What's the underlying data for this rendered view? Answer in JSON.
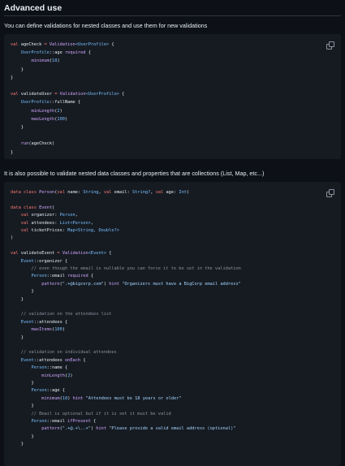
{
  "section": {
    "title": "Advanced use",
    "intro": "You can define validations for nested classes and use them for new validations",
    "middle": "It is also possible to validate nested data classes and properties that are collections (List, Map, etc...)"
  },
  "code1": {
    "lines": [
      [
        [
          "kw",
          "val "
        ],
        [
          "df",
          "ageCheck "
        ],
        [
          "kw",
          "= "
        ],
        [
          "fn",
          "Validation"
        ],
        [
          "tp",
          "<UserProfile>"
        ],
        [
          "df",
          " {"
        ]
      ],
      [
        [
          "tp",
          "    UserProfile"
        ],
        [
          "df",
          "::age "
        ],
        [
          "fn",
          "required"
        ],
        [
          "df",
          " {"
        ]
      ],
      [
        [
          "fn",
          "        minimum"
        ],
        [
          "df",
          "("
        ],
        [
          "nm",
          "18"
        ],
        [
          "df",
          ")"
        ]
      ],
      [
        [
          "df",
          "    }"
        ]
      ],
      [
        [
          "df",
          "}"
        ]
      ],
      [
        [
          "df",
          ""
        ]
      ],
      [
        [
          "kw",
          "val "
        ],
        [
          "df",
          "validateUser "
        ],
        [
          "kw",
          "= "
        ],
        [
          "fn",
          "Validation"
        ],
        [
          "tp",
          "<UserProfile>"
        ],
        [
          "df",
          " {"
        ]
      ],
      [
        [
          "tp",
          "    UserProfile"
        ],
        [
          "df",
          "::fullName {"
        ]
      ],
      [
        [
          "fn",
          "        minLength"
        ],
        [
          "df",
          "("
        ],
        [
          "nm",
          "2"
        ],
        [
          "df",
          ")"
        ]
      ],
      [
        [
          "fn",
          "        maxLength"
        ],
        [
          "df",
          "("
        ],
        [
          "nm",
          "100"
        ],
        [
          "df",
          ")"
        ]
      ],
      [
        [
          "df",
          "    }"
        ]
      ],
      [
        [
          "df",
          ""
        ]
      ],
      [
        [
          "fn",
          "    run"
        ],
        [
          "df",
          "(ageCheck)"
        ]
      ],
      [
        [
          "df",
          "}"
        ]
      ]
    ]
  },
  "code2": {
    "lines": [
      [
        [
          "kw",
          "data class "
        ],
        [
          "fn",
          "Person"
        ],
        [
          "df",
          "("
        ],
        [
          "kw",
          "val "
        ],
        [
          "df",
          "name: "
        ],
        [
          "tp",
          "String"
        ],
        [
          "df",
          ", "
        ],
        [
          "kw",
          "val "
        ],
        [
          "df",
          "email: "
        ],
        [
          "tp",
          "String?"
        ],
        [
          "df",
          ", "
        ],
        [
          "kw",
          "val "
        ],
        [
          "df",
          "age: "
        ],
        [
          "tp",
          "Int"
        ],
        [
          "df",
          ")"
        ]
      ],
      [
        [
          "df",
          ""
        ]
      ],
      [
        [
          "kw",
          "data class "
        ],
        [
          "fn",
          "Event"
        ],
        [
          "df",
          "("
        ]
      ],
      [
        [
          "kw",
          "    val "
        ],
        [
          "df",
          "organizer: "
        ],
        [
          "tp",
          "Person"
        ],
        [
          "df",
          ","
        ]
      ],
      [
        [
          "kw",
          "    val "
        ],
        [
          "df",
          "attendees: "
        ],
        [
          "tp",
          "List<Person>"
        ],
        [
          "df",
          ","
        ]
      ],
      [
        [
          "kw",
          "    val "
        ],
        [
          "df",
          "ticketPrices: "
        ],
        [
          "tp",
          "Map<String, Double?>"
        ]
      ],
      [
        [
          "df",
          ")"
        ]
      ],
      [
        [
          "df",
          ""
        ]
      ],
      [
        [
          "kw",
          "val "
        ],
        [
          "df",
          "validateEvent "
        ],
        [
          "kw",
          "= "
        ],
        [
          "fn",
          "Validation"
        ],
        [
          "tp",
          "<Event>"
        ],
        [
          "df",
          " {"
        ]
      ],
      [
        [
          "tp",
          "    Event"
        ],
        [
          "df",
          "::organizer {"
        ]
      ],
      [
        [
          "cm",
          "        // even though the email is nullable you can force it to be set in the validation"
        ]
      ],
      [
        [
          "tp",
          "        Person"
        ],
        [
          "df",
          "::email "
        ],
        [
          "fn",
          "required"
        ],
        [
          "df",
          " {"
        ]
      ],
      [
        [
          "fn",
          "            pattern"
        ],
        [
          "df",
          "("
        ],
        [
          "st",
          "\".+@bigcorp.com\""
        ],
        [
          "df",
          ") "
        ],
        [
          "fn",
          "hint "
        ],
        [
          "st",
          "\"Organizers must have a BigCorp email address\""
        ]
      ],
      [
        [
          "df",
          "        }"
        ]
      ],
      [
        [
          "df",
          "    }"
        ]
      ],
      [
        [
          "df",
          ""
        ]
      ],
      [
        [
          "cm",
          "    // validation on the attendees list"
        ]
      ],
      [
        [
          "tp",
          "    Event"
        ],
        [
          "df",
          "::attendees {"
        ]
      ],
      [
        [
          "fn",
          "        maxItems"
        ],
        [
          "df",
          "("
        ],
        [
          "nm",
          "100"
        ],
        [
          "df",
          ")"
        ]
      ],
      [
        [
          "df",
          "    }"
        ]
      ],
      [
        [
          "df",
          ""
        ]
      ],
      [
        [
          "cm",
          "    // validation on individual attendees"
        ]
      ],
      [
        [
          "tp",
          "    Event"
        ],
        [
          "df",
          "::attendees "
        ],
        [
          "fn",
          "onEach"
        ],
        [
          "df",
          " {"
        ]
      ],
      [
        [
          "tp",
          "        Person"
        ],
        [
          "df",
          "::name {"
        ]
      ],
      [
        [
          "fn",
          "            minLength"
        ],
        [
          "df",
          "("
        ],
        [
          "nm",
          "2"
        ],
        [
          "df",
          ")"
        ]
      ],
      [
        [
          "df",
          "        }"
        ]
      ],
      [
        [
          "tp",
          "        Person"
        ],
        [
          "df",
          "::age {"
        ]
      ],
      [
        [
          "fn",
          "            minimum"
        ],
        [
          "df",
          "("
        ],
        [
          "nm",
          "18"
        ],
        [
          "df",
          ") "
        ],
        [
          "fn",
          "hint "
        ],
        [
          "st",
          "\"Attendees must be 18 years or older\""
        ]
      ],
      [
        [
          "df",
          "        }"
        ]
      ],
      [
        [
          "cm",
          "        // Email is optional but if it is set it must be valid"
        ]
      ],
      [
        [
          "tp",
          "        Person"
        ],
        [
          "df",
          "::email "
        ],
        [
          "fn",
          "ifPresent"
        ],
        [
          "df",
          " {"
        ]
      ],
      [
        [
          "fn",
          "            pattern"
        ],
        [
          "df",
          "("
        ],
        [
          "st",
          "\".+@.+\\..+\""
        ],
        [
          "df",
          ") "
        ],
        [
          "fn",
          "hint "
        ],
        [
          "st",
          "\"Please provide a valid email address (optional)\""
        ]
      ],
      [
        [
          "df",
          "        }"
        ]
      ],
      [
        [
          "df",
          "    }"
        ]
      ]
    ]
  }
}
